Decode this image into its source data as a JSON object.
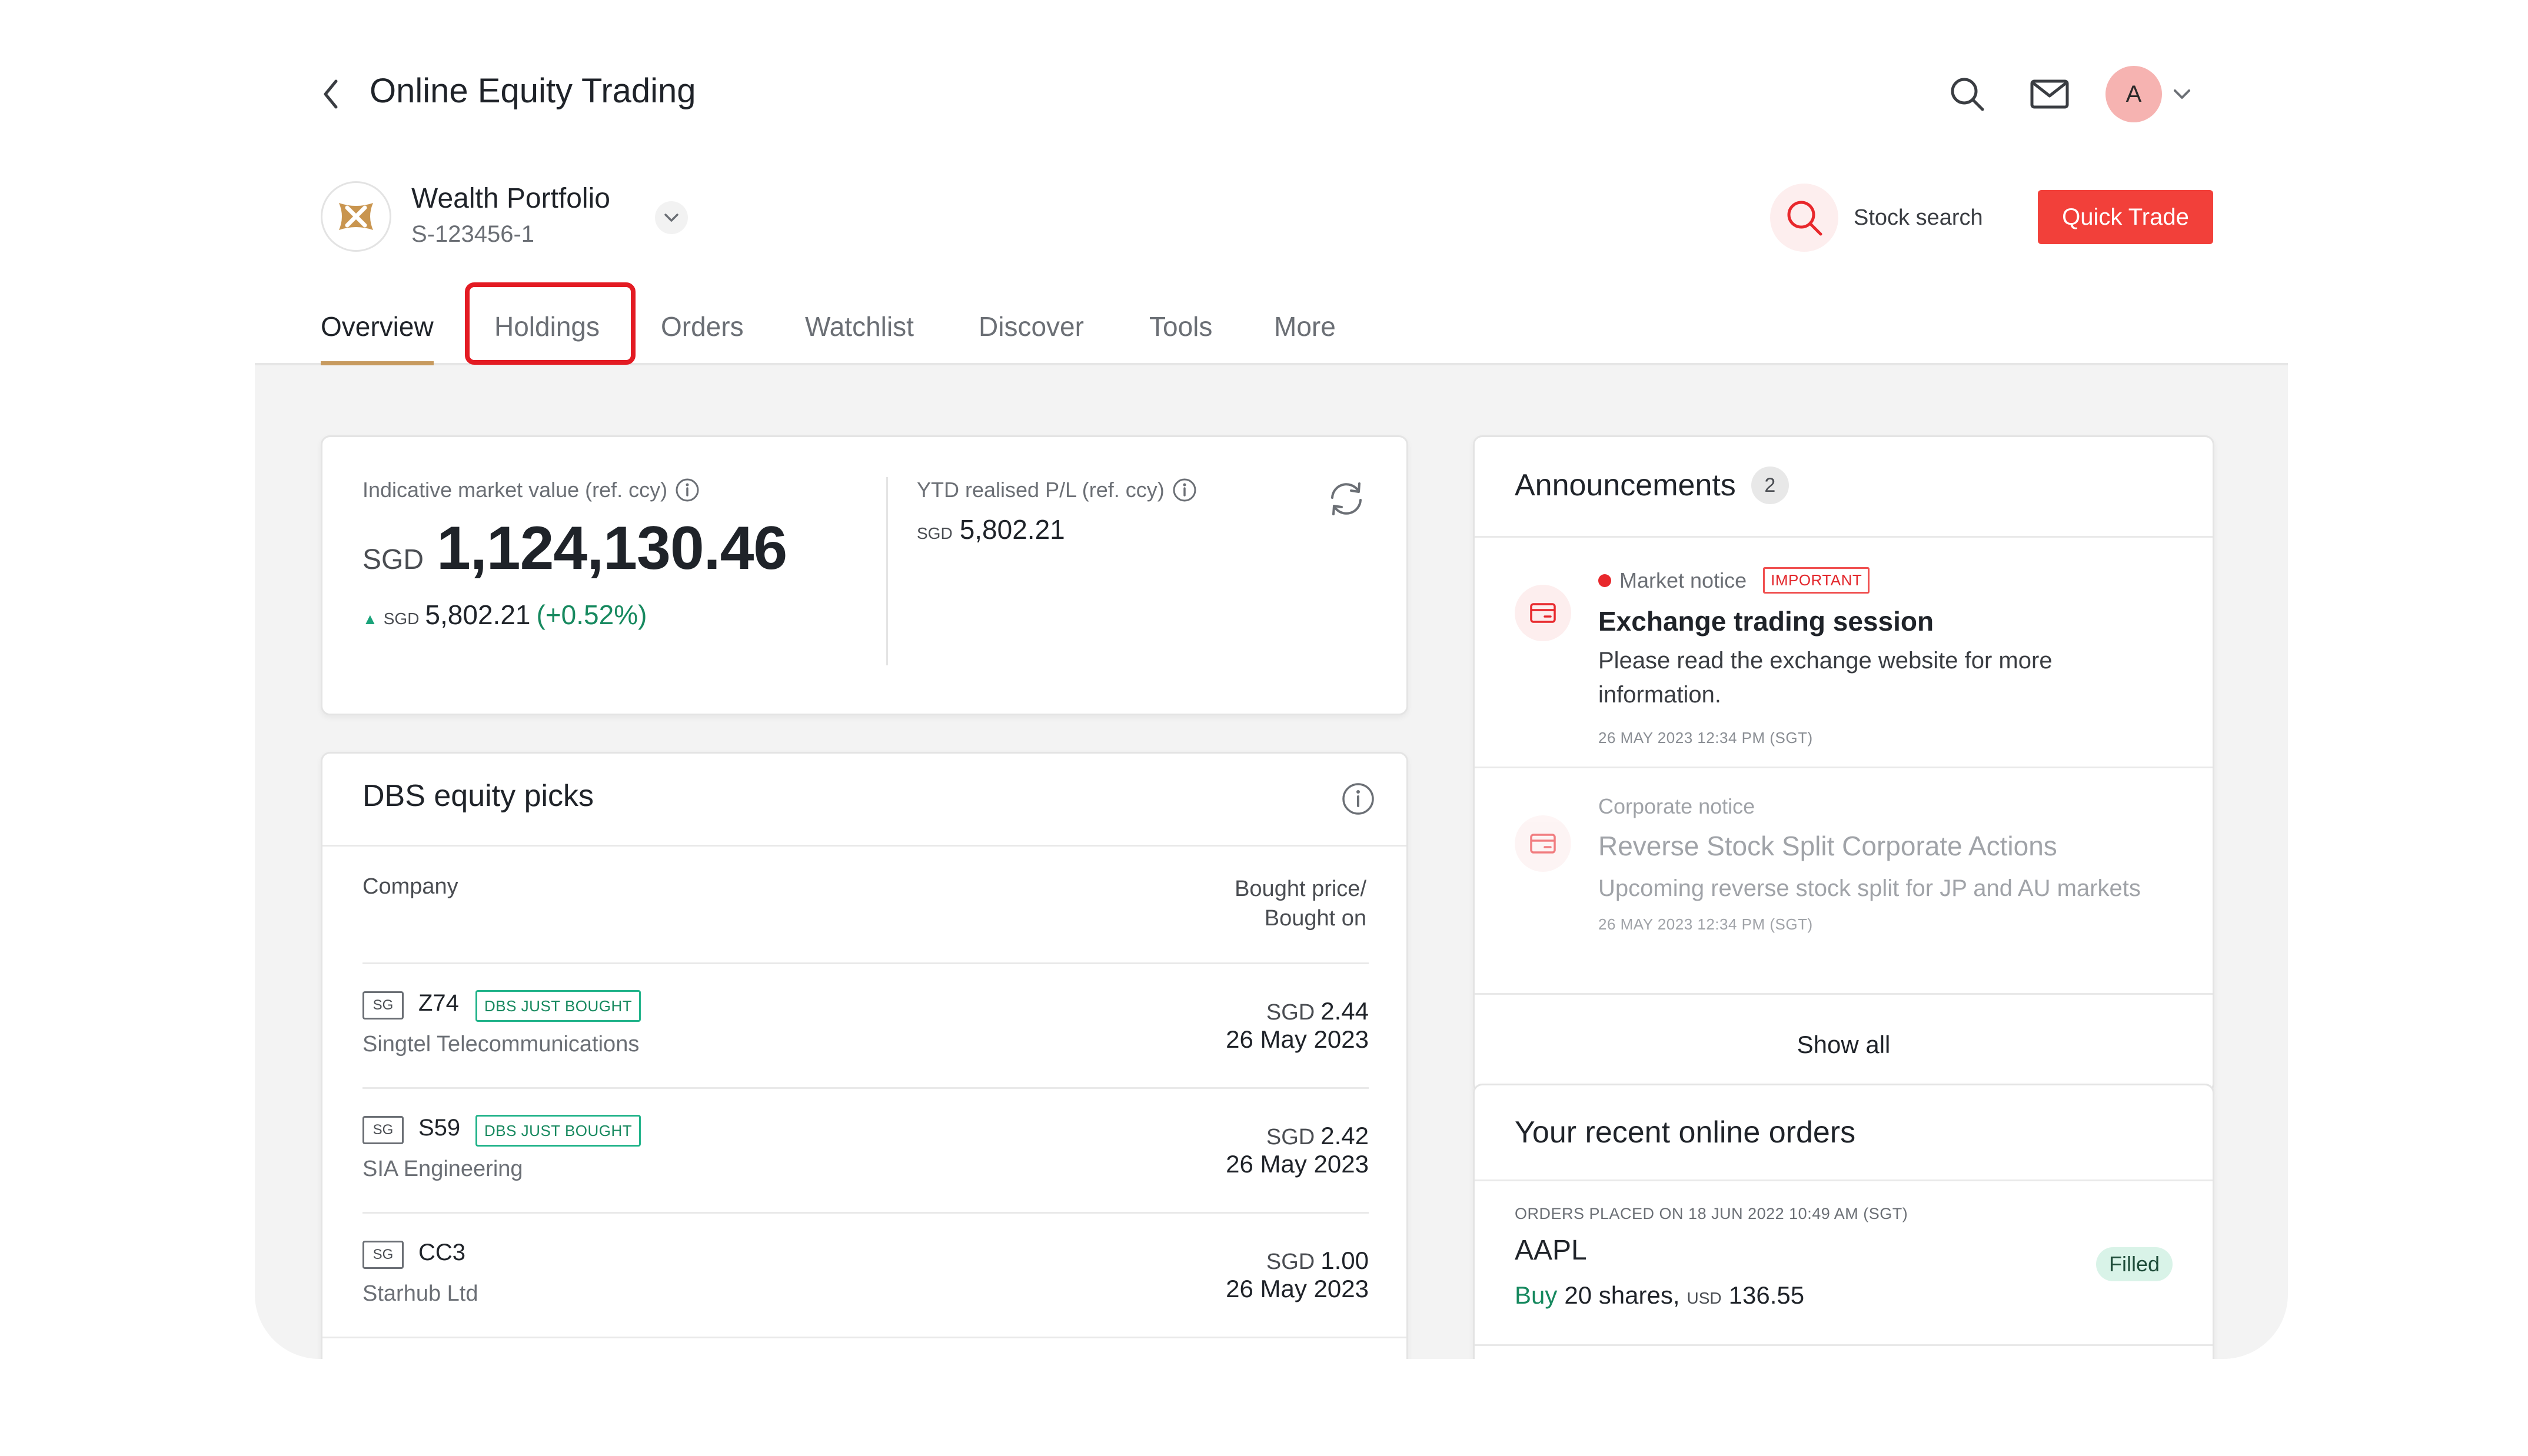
{
  "header": {
    "title": "Online Equity Trading",
    "avatar_initial": "A"
  },
  "portfolio": {
    "name": "Wealth Portfolio",
    "id": "S-123456-1",
    "stock_search_label": "Stock search",
    "quick_trade_label": "Quick Trade"
  },
  "tabs": [
    {
      "label": "Overview",
      "active": true
    },
    {
      "label": "Holdings",
      "active": false
    },
    {
      "label": "Orders",
      "active": false
    },
    {
      "label": "Watchlist",
      "active": false
    },
    {
      "label": "Discover",
      "active": false
    },
    {
      "label": "Tools",
      "active": false
    },
    {
      "label": "More",
      "active": false
    }
  ],
  "summary": {
    "market_value_label": "Indicative market value (ref. ccy)",
    "market_value_ccy": "SGD",
    "market_value": "1,124,130.46",
    "change_ccy": "SGD",
    "change_amount": "5,802.21",
    "change_pct": "(+0.52%)",
    "ytd_label": "YTD realised P/L (ref. ccy)",
    "ytd_ccy": "SGD",
    "ytd_amount": "5,802.21"
  },
  "picks": {
    "title": "DBS equity picks",
    "col_company": "Company",
    "col_bought_line1": "Bought price/",
    "col_bought_line2": "Bought on",
    "rows": [
      {
        "market": "SG",
        "code": "Z74",
        "badge": "DBS JUST BOUGHT",
        "name": "Singtel Telecommunications",
        "ccy": "SGD",
        "price": "2.44",
        "date": "26 May 2023"
      },
      {
        "market": "SG",
        "code": "S59",
        "badge": "DBS JUST BOUGHT",
        "name": "SIA Engineering",
        "ccy": "SGD",
        "price": "2.42",
        "date": "26 May 2023"
      },
      {
        "market": "SG",
        "code": "CC3",
        "badge": "",
        "name": "Starhub Ltd",
        "ccy": "SGD",
        "price": "1.00",
        "date": "26 May 2023"
      }
    ]
  },
  "announcements": {
    "title": "Announcements",
    "count": "2",
    "items": [
      {
        "type": "Market notice",
        "tag": "IMPORTANT",
        "headline": "Exchange trading session",
        "body": "Please read the exchange website for more information.",
        "time": "26 MAY 2023 12:34 PM (SGT)"
      },
      {
        "type": "Corporate notice",
        "tag": "",
        "headline": "Reverse Stock Split Corporate Actions",
        "body": "Upcoming reverse stock split for JP and AU markets",
        "time": "26 MAY 2023 12:34 PM (SGT)"
      }
    ],
    "show_all": "Show all"
  },
  "orders": {
    "title": "Your recent online orders",
    "placed": "ORDERS PLACED ON 18 JUN 2022 10:49 AM (SGT)",
    "symbol": "AAPL",
    "status": "Filled",
    "side": "Buy",
    "qty": "20 shares,",
    "ccy": "USD",
    "price": "136.55"
  },
  "colors": {
    "accent": "#f2403a",
    "tab_underline": "#c79a5e",
    "positive": "#17895f",
    "highlight_box": "#e31b23"
  },
  "icons": [
    "chevron-left-icon",
    "search-icon",
    "mail-icon",
    "chevron-down-icon",
    "portfolio-logo-icon",
    "info-icon",
    "refresh-icon",
    "card-icon"
  ]
}
